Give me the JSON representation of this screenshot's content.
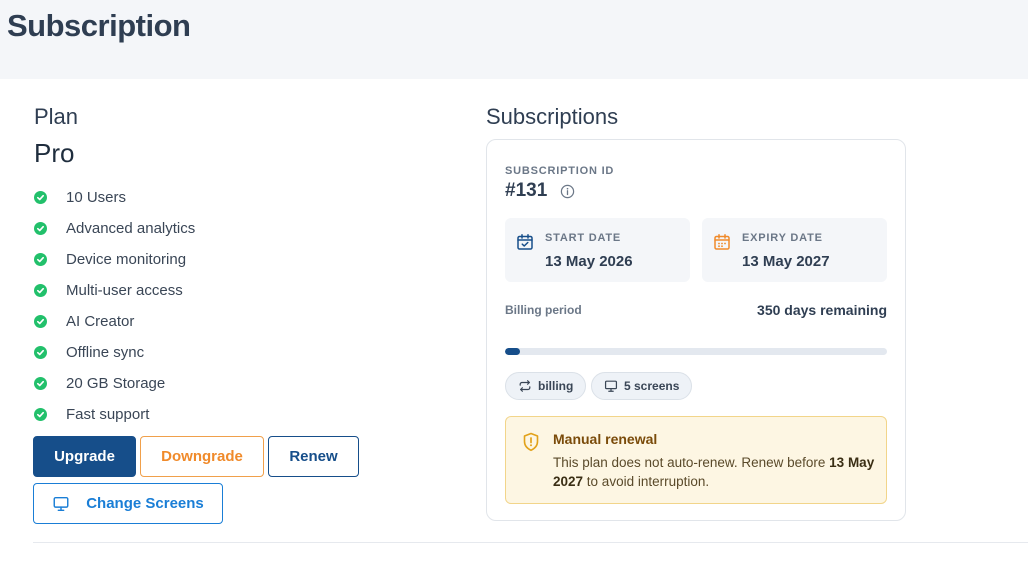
{
  "page": {
    "title": "Subscription"
  },
  "plan": {
    "label": "Plan",
    "name": "Pro",
    "features": [
      "10 Users",
      "Advanced analytics",
      "Device monitoring",
      "Multi-user access",
      "AI Creator",
      "Offline sync",
      "20 GB Storage",
      "Fast support"
    ],
    "check_color": "#22c06b"
  },
  "actions": {
    "upgrade": "Upgrade",
    "downgrade": "Downgrade",
    "renew": "Renew",
    "change_screens": "Change Screens"
  },
  "subscriptions": {
    "title": "Subscriptions",
    "id_label": "SUBSCRIPTION ID",
    "id_value": "#131",
    "start_label": "START DATE",
    "start_value": "13 May 2026",
    "expiry_label": "EXPIRY DATE",
    "expiry_value": "13 May 2027",
    "billing_period_label": "Billing period",
    "remaining": "350 days remaining",
    "progress_fraction": 0.04,
    "chips": {
      "billing": "billing",
      "screens": "5 screens"
    },
    "notice": {
      "title": "Manual renewal",
      "text_before": "This plan does not auto-renew. Renew before ",
      "date": "13 May 2027",
      "text_after": " to avoid interruption."
    }
  },
  "colors": {
    "primary": "#164e8a",
    "downgrade": "#f08a2a",
    "link": "#1a7ed6",
    "success": "#22c06b",
    "warning_bg": "#fdf6e3",
    "warning_border": "#f2d58a"
  }
}
